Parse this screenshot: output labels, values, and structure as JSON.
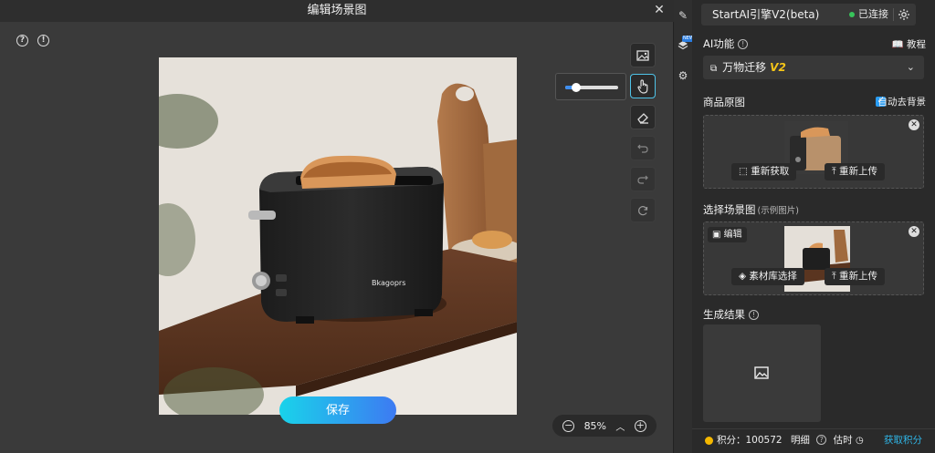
{
  "dialog": {
    "title": "编辑场景图",
    "save_label": "保存",
    "zoom": "85%"
  },
  "photo": {
    "brand_text": "Bkagoprs"
  },
  "panel": {
    "engine": "StartAI引擎V2(beta)",
    "status": "已连接",
    "ai_section": "AI功能",
    "tutorial": "教程",
    "feature_select": "万物迁移",
    "feature_version": "V2",
    "product_section": "商品原图",
    "auto_remove_bg": "自动去背景",
    "refetch": "重新获取",
    "reupload": "重新上传",
    "scene_section": "选择场景图",
    "scene_hint": "(示例图片)",
    "edit_chip": "编辑",
    "library_select": "素材库选择",
    "reupload2": "重新上传",
    "result_section": "生成结果",
    "points_label": "积分：",
    "points_value": "100572",
    "detail": "明细",
    "estimate": "估时",
    "get_points": "获取积分"
  },
  "colors": {
    "accent": "#2fb5e6",
    "status_green": "#37c45a",
    "save_gradient_start": "#19d3ea",
    "save_gradient_end": "#3d7af2"
  },
  "slider": {
    "value": 0.2
  }
}
